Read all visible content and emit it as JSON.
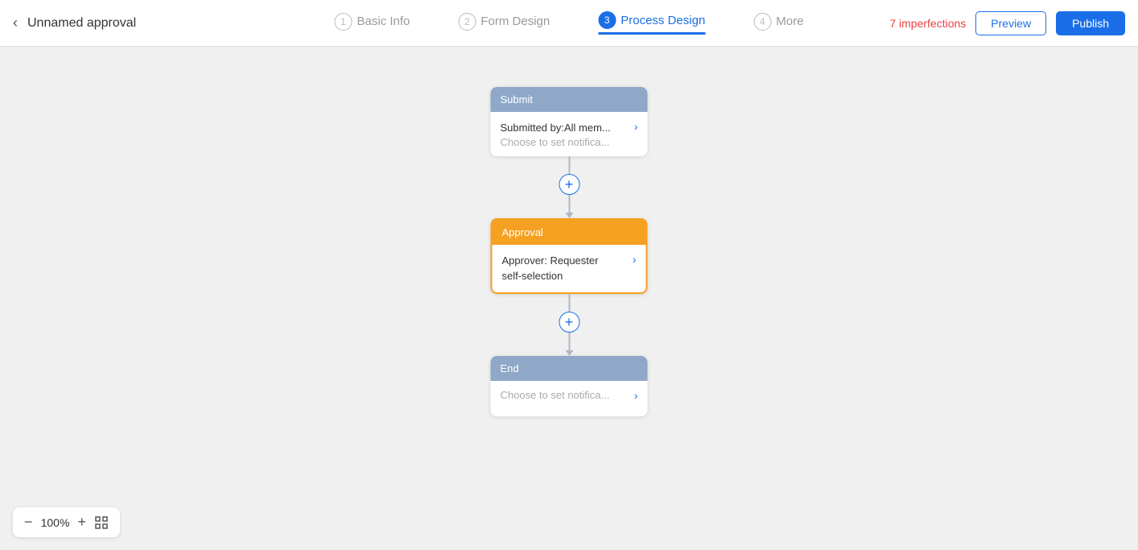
{
  "header": {
    "back_label": "",
    "title": "Unnamed approval",
    "tabs": [
      {
        "step": "1",
        "label": "Basic Info",
        "active": false
      },
      {
        "step": "2",
        "label": "Form Design",
        "active": false
      },
      {
        "step": "3",
        "label": "Process Design",
        "active": true
      },
      {
        "step": "4",
        "label": "More",
        "active": false
      }
    ],
    "imperfections_label": "7 imperfections",
    "preview_label": "Preview",
    "publish_label": "Publish"
  },
  "canvas": {
    "nodes": [
      {
        "id": "submit",
        "header": "Submit",
        "header_type": "gray",
        "line1": "Submitted by:All mem...",
        "line2": "Choose to set notifica...",
        "line2_gray": true
      },
      {
        "id": "approval",
        "header": "Approval",
        "header_type": "orange",
        "line1": "Approver: Requester",
        "line2": "self-selection",
        "line2_gray": false
      },
      {
        "id": "end",
        "header": "End",
        "header_type": "gray",
        "line1": "Choose to set notifica...",
        "line2": "",
        "line2_gray": true
      }
    ]
  },
  "zoom": {
    "level": "100%",
    "zoom_in_icon": "+",
    "zoom_out_icon": "−",
    "fit_icon": "⛶"
  }
}
